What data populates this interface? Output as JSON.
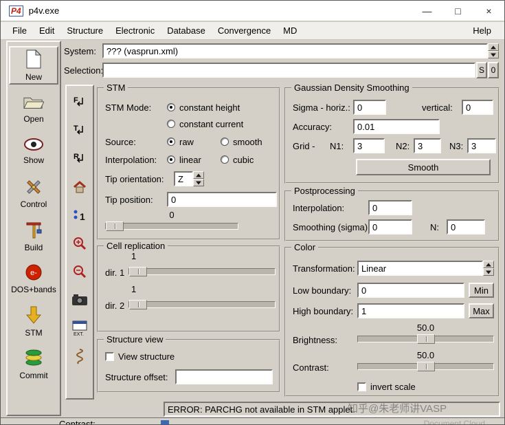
{
  "window": {
    "icon_text": "P4",
    "title": "p4v.exe",
    "minimize": "—",
    "maximize": "□",
    "close": "×"
  },
  "menu": {
    "items": [
      "File",
      "Edit",
      "Structure",
      "Electronic",
      "Database",
      "Convergence",
      "MD"
    ],
    "help": "Help"
  },
  "header": {
    "system_label": "System:",
    "system_value": "??? (vasprun.xml)",
    "selection_label": "Selection:",
    "selection_value": "",
    "select_button": "S",
    "count_button": "0"
  },
  "sidebar": {
    "items": [
      {
        "label": "New"
      },
      {
        "label": "Open"
      },
      {
        "label": "Show"
      },
      {
        "label": "Control"
      },
      {
        "label": "Build"
      },
      {
        "label": "DOS+bands"
      },
      {
        "label": "STM"
      },
      {
        "label": "Commit"
      }
    ],
    "dos_icon_text": "e-"
  },
  "toolcolumn": {
    "letters": [
      "F",
      "T",
      "R"
    ],
    "ext_label": "EXT."
  },
  "stm": {
    "title": "STM",
    "mode_label": "STM Mode:",
    "mode_height": "constant height",
    "mode_current": "constant current",
    "source_label": "Source:",
    "source_raw": "raw",
    "source_smooth": "smooth",
    "interpolation_label": "Interpolation:",
    "interp_linear": "linear",
    "interp_cubic": "cubic",
    "tip_orientation_label": "Tip orientation:",
    "tip_orientation_value": "Z",
    "tip_position_label": "Tip position:",
    "tip_position_value": "0",
    "layer_value": "0"
  },
  "cell_replication": {
    "title": "Cell replication",
    "dir1_label": "dir. 1",
    "dir1_value": "1",
    "dir2_label": "dir. 2",
    "dir2_value": "1"
  },
  "structure_view": {
    "title": "Structure view",
    "view_structure_label": "View structure",
    "offset_label": "Structure offset:",
    "offset_value": ""
  },
  "gaussian": {
    "title": "Gaussian Density Smoothing",
    "sigma_label": "Sigma - horiz.:",
    "sigma_horiz_value": "0",
    "vertical_label": "vertical:",
    "vertical_value": "0",
    "accuracy_label": "Accuracy:",
    "accuracy_value": "0.01",
    "grid_label": "Grid -",
    "n1_label": "N1:",
    "n1_value": "3",
    "n2_label": "N2:",
    "n2_value": "3",
    "n3_label": "N3:",
    "n3_value": "3",
    "smooth_button": "Smooth"
  },
  "postprocessing": {
    "title": "Postprocessing",
    "interpolation_label": "Interpolation:",
    "interpolation_value": "0",
    "smoothing_label": "Smoothing (sigma):",
    "smoothing_value": "0",
    "n_label": "N:",
    "n_value": "0"
  },
  "color": {
    "title": "Color",
    "transformation_label": "Transformation:",
    "transformation_value": "Linear",
    "low_label": "Low boundary:",
    "low_value": "0",
    "min_button": "Min",
    "high_label": "High boundary:",
    "high_value": "1",
    "max_button": "Max",
    "brightness_label": "Brightness:",
    "brightness_value": "50.0",
    "contrast_label": "Contrast:",
    "contrast_value": "50.0",
    "invert_label": "invert scale"
  },
  "status": {
    "message": "ERROR: PARCHG not available in STM applet."
  },
  "watermark": "知乎@朱老师讲VASP",
  "bottom_strip": {
    "contrast_label": "Contrast:",
    "partial_text": "Document Cloud"
  },
  "colors": {
    "window_bg": "#d4d0c8",
    "titlebar_bg": "#ffffff",
    "electron_icon": "#cc2200",
    "stm_arrow": "#e8b020"
  }
}
